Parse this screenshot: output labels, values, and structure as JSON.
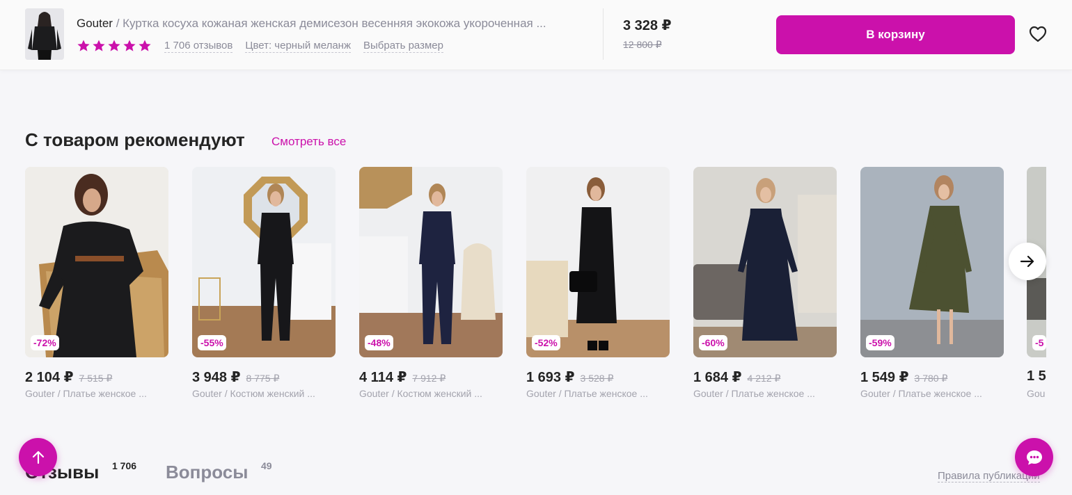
{
  "product_bar": {
    "brand": "Gouter",
    "separator": " / ",
    "title": "Куртка косуха кожаная женская демисезон весенняя экокожа укороченная ...",
    "rating_stars": 5,
    "reviews_link": "1 706 отзывов",
    "color_link": "Цвет: черный меланж",
    "size_link": "Выбрать размер",
    "price_current": "3 328 ₽",
    "price_old": "12 800 ₽",
    "cart_button": "В корзину",
    "favorite_icon": "heart-icon"
  },
  "recommendations": {
    "title": "С товаром рекомендуют",
    "see_all": "Смотреть все",
    "items": [
      {
        "discount": "-72%",
        "price": "2 104 ₽",
        "old_price": "7 515 ₽",
        "name": "Gouter / Платье женское ..."
      },
      {
        "discount": "-55%",
        "price": "3 948 ₽",
        "old_price": "8 775 ₽",
        "name": "Gouter / Костюм женский ..."
      },
      {
        "discount": "-48%",
        "price": "4 114 ₽",
        "old_price": "7 912 ₽",
        "name": "Gouter / Костюм женский ..."
      },
      {
        "discount": "-52%",
        "price": "1 693 ₽",
        "old_price": "3 528 ₽",
        "name": "Gouter / Платье женское ..."
      },
      {
        "discount": "-60%",
        "price": "1 684 ₽",
        "old_price": "4 212 ₽",
        "name": "Gouter / Платье женское ..."
      },
      {
        "discount": "-59%",
        "price": "1 549 ₽",
        "old_price": "3 780 ₽",
        "name": "Gouter / Платье женское ..."
      },
      {
        "discount": "-5",
        "price": "1 5",
        "old_price": "",
        "name": "Gou"
      }
    ],
    "next_icon": "arrow-right-icon"
  },
  "tabs": {
    "reviews_label": "Отзывы",
    "reviews_count": "1 706",
    "questions_label": "Вопросы",
    "questions_count": "49",
    "rules_link": "Правила публикации"
  },
  "floating": {
    "scroll_top_icon": "arrow-up-icon",
    "chat_icon": "chat-icon"
  },
  "colors": {
    "accent": "#cb11ab",
    "background": "#f6f6f9",
    "text": "#242424",
    "muted": "#8b8b99"
  }
}
